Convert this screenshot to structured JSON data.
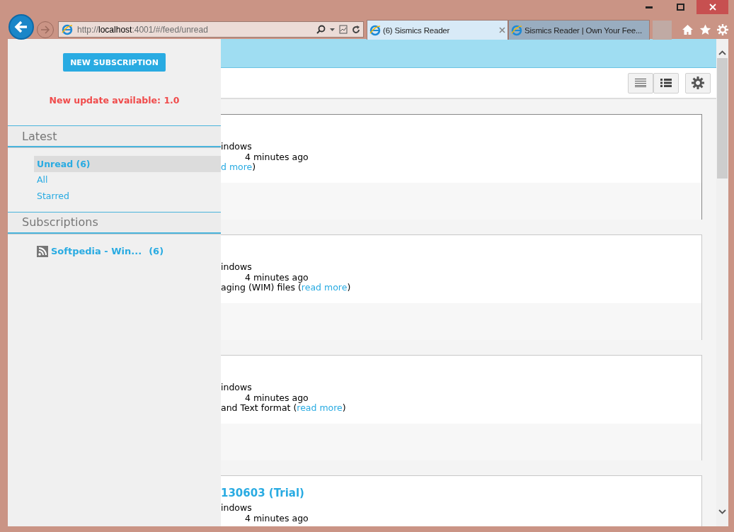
{
  "browser": {
    "address": {
      "prefix": "http://",
      "host": "localhost",
      "path": ":4001/#/feed/unread"
    },
    "tabs": [
      {
        "label": "(6) Sismics Reader",
        "selected": true
      },
      {
        "label": "Sismics Reader | Own Your Fee...",
        "selected": false
      }
    ]
  },
  "sidebar": {
    "button": "NEW SUBSCRIPTION",
    "update_notice": "New update available: 1.0",
    "sections": [
      {
        "title": "Latest",
        "items": [
          {
            "kind": "link",
            "label": "Unread (6)",
            "selected": true
          },
          {
            "kind": "link",
            "label": "All",
            "selected": false
          },
          {
            "kind": "link",
            "label": "Starred",
            "selected": false
          }
        ]
      },
      {
        "title": "Subscriptions",
        "items": [
          {
            "kind": "feed",
            "label": "Softpedia - Win...",
            "count": "(6)",
            "selected": false
          }
        ]
      }
    ]
  },
  "articles": [
    {
      "source": "indows",
      "time": "4 minutes ago",
      "link": "d more",
      "suffix": ")"
    },
    {
      "source": "indows",
      "time": "4 minutes ago",
      "summary": "aging (WIM) files (",
      "link": "read more",
      "suffix": ")"
    },
    {
      "source": "indows",
      "time": "4 minutes ago",
      "summary": "and Text format (",
      "link": "read more",
      "suffix": ")"
    },
    {
      "title": "130603 (Trial)",
      "source": "indows",
      "time": "4 minutes ago"
    }
  ]
}
